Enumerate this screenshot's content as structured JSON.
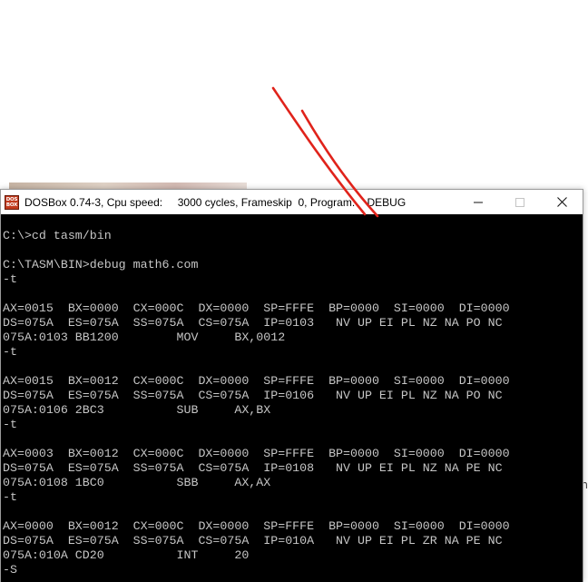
{
  "background": {
    "right_edge_text": "th"
  },
  "window": {
    "icon_label": "DOS BOX",
    "title": "DOSBox 0.74-3, Cpu speed:     3000 cycles, Frameskip  0, Program:    DEBUG",
    "controls": {
      "minimize": "minimize-icon",
      "maximize": "maximize-icon",
      "close": "close-icon"
    }
  },
  "colors": {
    "console_bg": "#000000",
    "console_text": "#c6c6c6",
    "annotation": "#e0231b"
  },
  "console": {
    "lines": [
      "C:\\>cd tasm/bin",
      "",
      "C:\\TASM\\BIN>debug math6.com",
      "-t",
      "",
      "AX=0015  BX=0000  CX=000C  DX=0000  SP=FFFE  BP=0000  SI=0000  DI=0000",
      "DS=075A  ES=075A  SS=075A  CS=075A  IP=0103   NV UP EI PL NZ NA PO NC",
      "075A:0103 BB1200        MOV     BX,0012",
      "-t",
      "",
      "AX=0015  BX=0012  CX=000C  DX=0000  SP=FFFE  BP=0000  SI=0000  DI=0000",
      "DS=075A  ES=075A  SS=075A  CS=075A  IP=0106   NV UP EI PL NZ NA PO NC",
      "075A:0106 2BC3          SUB     AX,BX",
      "-t",
      "",
      "AX=0003  BX=0012  CX=000C  DX=0000  SP=FFFE  BP=0000  SI=0000  DI=0000",
      "DS=075A  ES=075A  SS=075A  CS=075A  IP=0108   NV UP EI PL NZ NA PE NC",
      "075A:0108 1BC0          SBB     AX,AX",
      "-t",
      "",
      "AX=0000  BX=0012  CX=000C  DX=0000  SP=FFFE  BP=0000  SI=0000  DI=0000",
      "DS=075A  ES=075A  SS=075A  CS=075A  IP=010A   NV UP EI PL ZR NA PE NC",
      "075A:010A CD20          INT     20",
      "-S"
    ]
  }
}
